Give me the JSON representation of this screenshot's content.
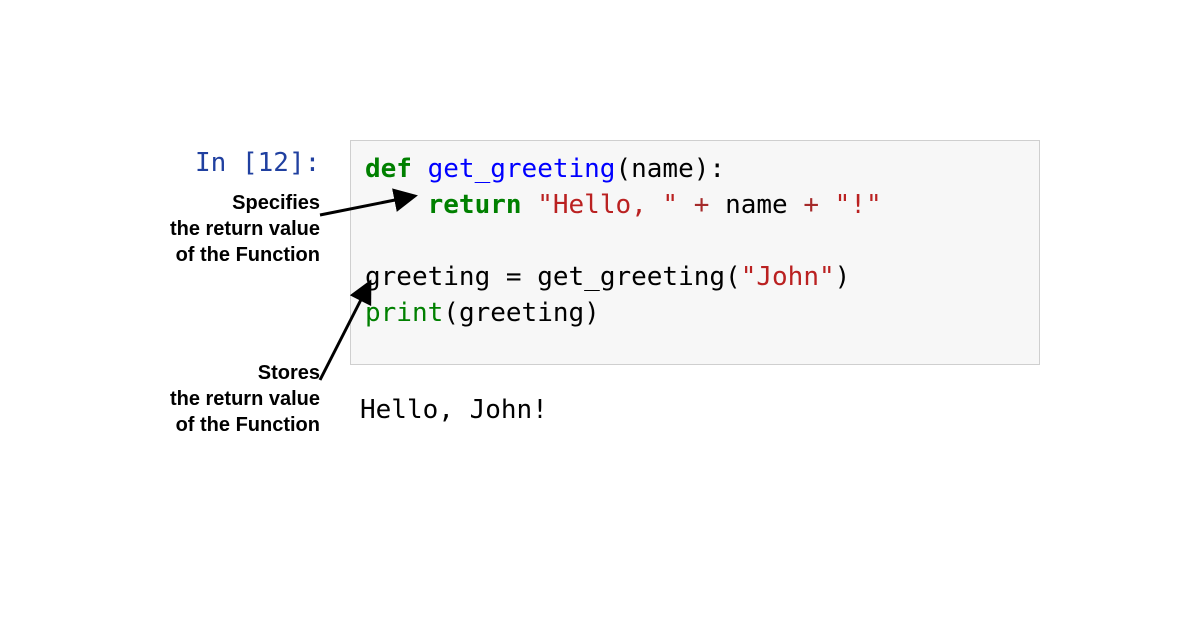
{
  "prompt": {
    "in": "In ",
    "open": "[",
    "num": "12",
    "close": "]: "
  },
  "code": {
    "l1_def": "def",
    "l1_sp1": " ",
    "l1_func": "get_greeting",
    "l1_paren_open": "(",
    "l1_param": "name",
    "l1_paren_close": ")",
    "l1_colon": ":",
    "l2_indent": "    ",
    "l2_return": "return",
    "l2_sp": " ",
    "l2_str1": "\"Hello, \"",
    "l2_sp2": " ",
    "l2_plus1": "+",
    "l2_sp3": " ",
    "l2_name": "name",
    "l2_sp4": " ",
    "l2_plus2": "+",
    "l2_sp5": " ",
    "l2_str2": "\"!\"",
    "l4_var": "greeting",
    "l4_sp1": " ",
    "l4_eq": "=",
    "l4_sp2": " ",
    "l4_call": "get_greeting",
    "l4_paren_open": "(",
    "l4_arg": "\"John\"",
    "l4_paren_close": ")",
    "l5_print": "print",
    "l5_paren_open": "(",
    "l5_arg": "greeting",
    "l5_paren_close": ")"
  },
  "output": "Hello, John!",
  "annotations": {
    "specifies": "Specifies\nthe return value\nof the Function",
    "stores": "Stores\nthe return value\nof the Function"
  },
  "colors": {
    "cell_bg": "#f7f7f7",
    "cell_border": "#cfcfcf",
    "keyword": "#008000",
    "funcname": "#0000ff",
    "string": "#ba2121",
    "operator": "#a52a2a",
    "prompt": "#2040a0"
  }
}
